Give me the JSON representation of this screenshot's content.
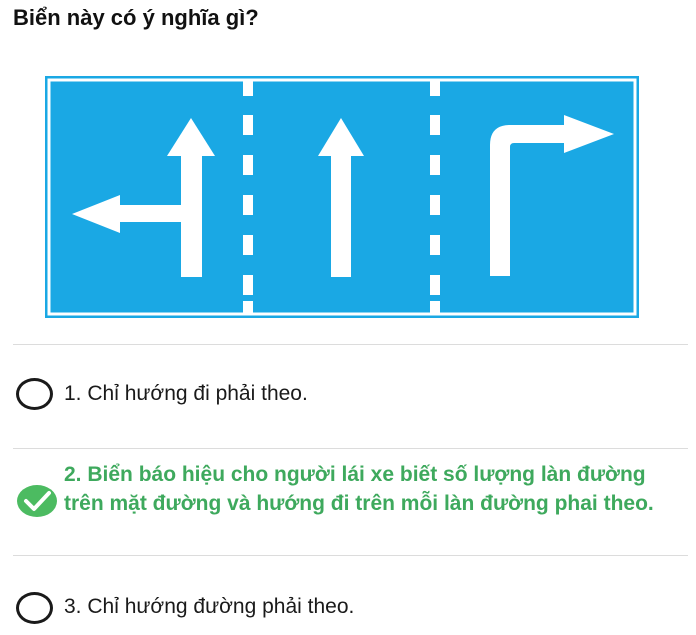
{
  "question": {
    "text": "Biển này có ý nghĩa gì?"
  },
  "sign": {
    "background_color": "#1aa8e4",
    "marking_color": "#ffffff",
    "lanes": [
      {
        "arrow": "left-turn-and-straight-arrow"
      },
      {
        "arrow": "straight-arrow"
      },
      {
        "arrow": "right-turn-arrow"
      }
    ]
  },
  "options": [
    {
      "label": "1. Chỉ hướng đi phải theo.",
      "selected": false,
      "correct": false
    },
    {
      "label": "2. Biển báo hiệu cho người lái xe biết số lượng làn đường trên mặt đường và hướng đi trên mỗi làn đường phai theo.",
      "selected": true,
      "correct": true
    },
    {
      "label": "3. Chỉ hướng đường phải theo.",
      "selected": false,
      "correct": false
    }
  ],
  "colors": {
    "correct_text": "#3ea95d",
    "check_fill": "#4cbb61",
    "radio_border": "#1a1a1a"
  }
}
